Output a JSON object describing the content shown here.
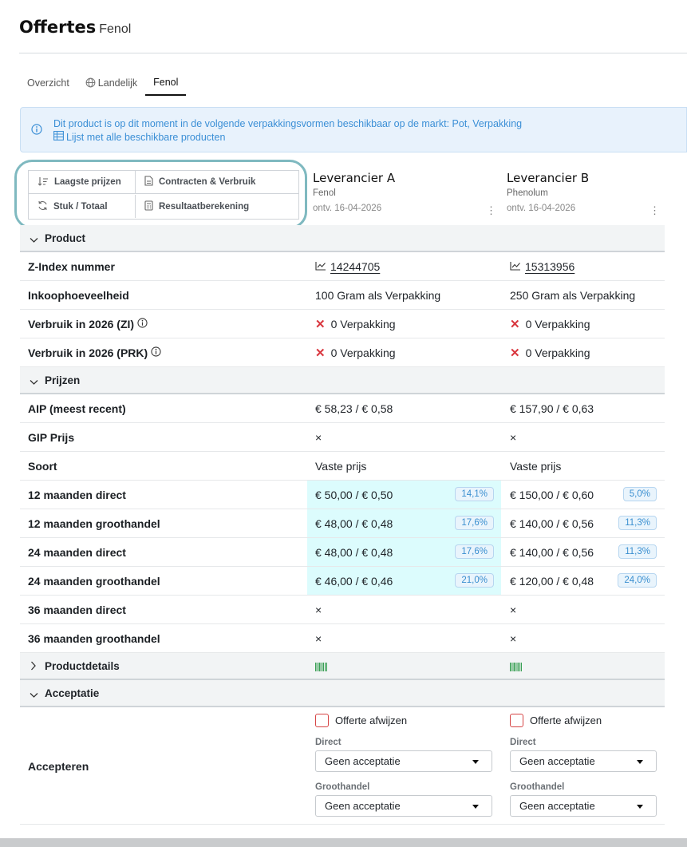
{
  "header": {
    "title": "Offertes",
    "subtitle": "Fenol"
  },
  "tabs": [
    {
      "label": "Overzicht",
      "active": false
    },
    {
      "label": "Landelijk",
      "icon": "globe-icon",
      "active": false
    },
    {
      "label": "Fenol",
      "active": true
    }
  ],
  "info": {
    "message": "Dit product is op dit moment in de volgende verpakkingsvormen beschikbaar op de markt: Pot, Verpakking",
    "link": "Lijst met alle beschikbare producten",
    "color": "#3b8fd6"
  },
  "controls": {
    "lowest_prices": "Laagste prijzen",
    "contracts": "Contracten & Verbruik",
    "unit_total": "Stuk / Totaal",
    "result_calc": "Resultaatberekening"
  },
  "vendors": [
    {
      "name": "Leverancier A",
      "product": "Fenol",
      "received": "ontv. 16-04-2026"
    },
    {
      "name": "Leverancier B",
      "product": "Phenolum",
      "received": "ontv. 16-04-2026"
    }
  ],
  "sections": {
    "product": "Product",
    "prices": "Prijzen",
    "productdetails": "Productdetails",
    "acceptance": "Acceptatie"
  },
  "rows": {
    "zindex": {
      "label": "Z-Index nummer",
      "a": "14244705",
      "b": "15313956"
    },
    "quantity": {
      "label": "Inkoophoeveelheid",
      "a": "100 Gram als Verpakking",
      "b": "250 Gram als Verpakking"
    },
    "usage_zi": {
      "label": "Verbruik in 2026 (ZI)",
      "a": "0 Verpakking",
      "b": "0 Verpakking"
    },
    "usage_prk": {
      "label": "Verbruik in 2026 (PRK)",
      "a": "0 Verpakking",
      "b": "0 Verpakking"
    },
    "aip": {
      "label": "AIP (meest recent)",
      "a": "€ 58,23 / € 0,58",
      "b": "€ 157,90 / € 0,63"
    },
    "gip": {
      "label": "GIP Prijs",
      "a": "×",
      "b": "×"
    },
    "kind": {
      "label": "Soort",
      "a": "Vaste prijs",
      "b": "Vaste prijs"
    },
    "m12d": {
      "label": "12 maanden direct",
      "a": "€ 50,00 / € 0,50",
      "a_pct": "14,1%",
      "b": "€ 150,00 / € 0,60",
      "b_pct": "5,0%"
    },
    "m12g": {
      "label": "12 maanden groothandel",
      "a": "€ 48,00 / € 0,48",
      "a_pct": "17,6%",
      "b": "€ 140,00 / € 0,56",
      "b_pct": "11,3%"
    },
    "m24d": {
      "label": "24 maanden direct",
      "a": "€ 48,00 / € 0,48",
      "a_pct": "17,6%",
      "b": "€ 140,00 / € 0,56",
      "b_pct": "11,3%"
    },
    "m24g": {
      "label": "24 maanden groothandel",
      "a": "€ 46,00 / € 0,46",
      "a_pct": "21,0%",
      "b": "€ 120,00 / € 0,48",
      "b_pct": "24,0%"
    },
    "m36d": {
      "label": "36 maanden direct",
      "a": "×",
      "b": "×"
    },
    "m36g": {
      "label": "36 maanden groothandel",
      "a": "×",
      "b": "×"
    }
  },
  "acceptance": {
    "label": "Accepteren",
    "reject": "Offerte afwijzen",
    "direct_label": "Direct",
    "wholesale_label": "Groothandel",
    "select_value": "Geen acceptatie"
  },
  "colors": {
    "best_price_bg": "#dcfcfd",
    "badge": "#3a8fd0",
    "reject_red": "#d64545",
    "ring": "#7fb9c0"
  }
}
